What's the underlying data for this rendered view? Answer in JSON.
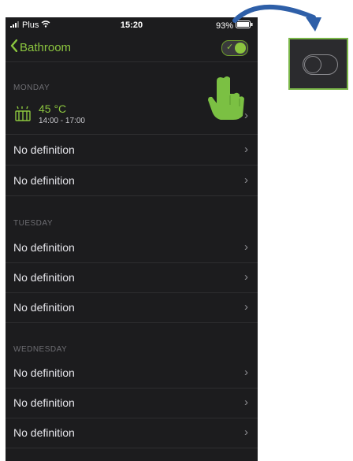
{
  "statusbar": {
    "carrier": "Plus",
    "time": "15:20",
    "battery": "93%"
  },
  "navbar": {
    "back_label": "Bathroom",
    "toggle_on": true
  },
  "days": [
    {
      "name": "MONDAY",
      "rows": [
        {
          "type": "heating",
          "temperature": "45 °C",
          "time_range": "14:00 - 17:00"
        },
        {
          "type": "empty",
          "label": "No definition"
        },
        {
          "type": "empty",
          "label": "No definition"
        }
      ]
    },
    {
      "name": "TUESDAY",
      "rows": [
        {
          "type": "empty",
          "label": "No definition"
        },
        {
          "type": "empty",
          "label": "No definition"
        },
        {
          "type": "empty",
          "label": "No definition"
        }
      ]
    },
    {
      "name": "WEDNESDAY",
      "rows": [
        {
          "type": "empty",
          "label": "No definition"
        },
        {
          "type": "empty",
          "label": "No definition"
        },
        {
          "type": "empty",
          "label": "No definition"
        }
      ]
    }
  ],
  "icons": {
    "back": "chevron-left-icon",
    "row": "chevron-right-icon",
    "heating": "radiator-icon",
    "pointer": "hand-pointer-icon",
    "arrow": "curved-arrow-icon"
  },
  "colors": {
    "accent": "#8cc63f",
    "background": "#1c1c1e",
    "callout_border": "#7ab648",
    "arrow": "#2e5fa8"
  }
}
